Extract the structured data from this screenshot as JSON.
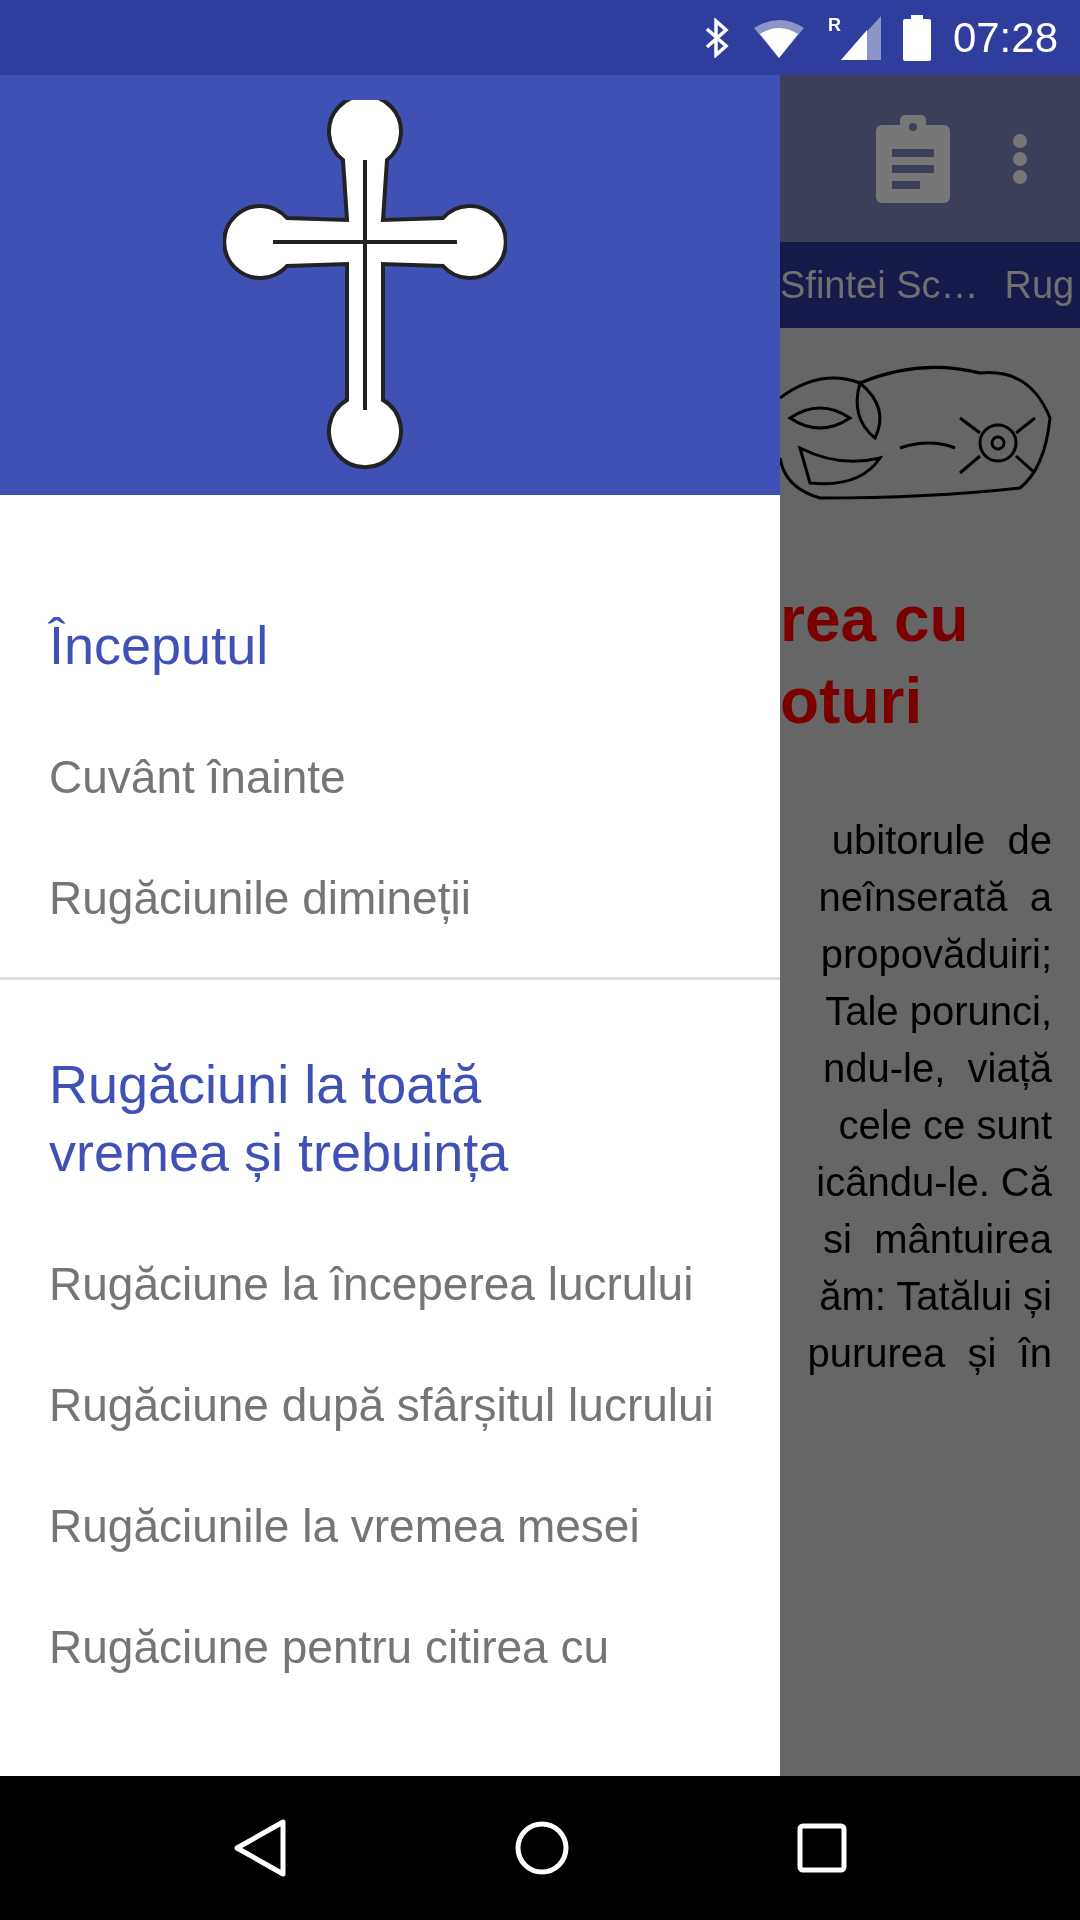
{
  "status_bar": {
    "time": "07:28",
    "roaming": "R"
  },
  "drawer": {
    "sections": [
      {
        "title": "Începutul",
        "items": [
          {
            "label": "Cuvânt înainte"
          },
          {
            "label": "Rugăciunile dimineții"
          }
        ]
      },
      {
        "title": "Rugăciuni la toată vremea și trebuința",
        "items": [
          {
            "label": "Rugăciune la începerea lucrului"
          },
          {
            "label": "Rugăciune după sfârșitul lucrului"
          },
          {
            "label": "Rugăciunile la vremea mesei"
          },
          {
            "label": "Rugăciune pentru citirea cu"
          }
        ]
      }
    ]
  },
  "background": {
    "tabs": [
      "Sfintei Sc…",
      "Rug"
    ],
    "heading": [
      "rea cu",
      "oturi"
    ],
    "body": [
      "ubitorule  de",
      "neînserată  a",
      "propovăduiri;",
      "Tale porunci,",
      "ndu-le,  viață",
      "cele ce sunt",
      "icându-le. Că",
      "si  mântuirea",
      "ăm: Tatălui și",
      "pururea  și  în"
    ]
  }
}
